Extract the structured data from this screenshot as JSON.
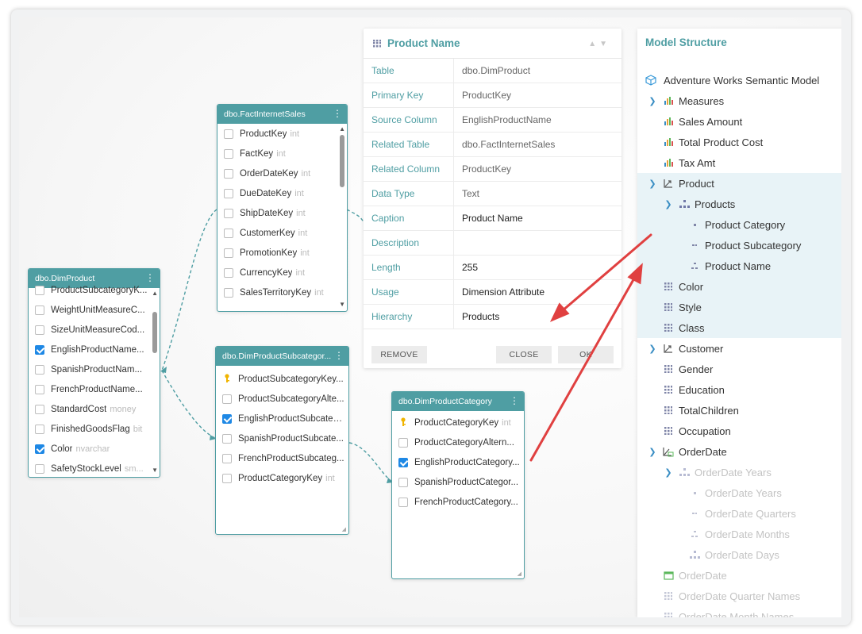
{
  "tables": {
    "fact_internet_sales": {
      "title": "dbo.FactInternetSales",
      "rows": [
        {
          "name": "ProductKey",
          "type": "int"
        },
        {
          "name": "FactKey",
          "type": "int"
        },
        {
          "name": "OrderDateKey",
          "type": "int"
        },
        {
          "name": "DueDateKey",
          "type": "int"
        },
        {
          "name": "ShipDateKey",
          "type": "int"
        },
        {
          "name": "CustomerKey",
          "type": "int"
        },
        {
          "name": "PromotionKey",
          "type": "int"
        },
        {
          "name": "CurrencyKey",
          "type": "int"
        },
        {
          "name": "SalesTerritoryKey",
          "type": "int"
        }
      ]
    },
    "dim_product": {
      "title": "dbo.DimProduct",
      "rows": [
        {
          "name": "ProductSubcategoryK...",
          "type": ""
        },
        {
          "name": "WeightUnitMeasureC...",
          "type": ""
        },
        {
          "name": "SizeUnitMeasureCod...",
          "type": ""
        },
        {
          "name": "EnglishProductName...",
          "type": ""
        },
        {
          "name": "SpanishProductNam...",
          "type": ""
        },
        {
          "name": "FrenchProductName...",
          "type": ""
        },
        {
          "name": "StandardCost",
          "type": "money"
        },
        {
          "name": "FinishedGoodsFlag",
          "type": "bit"
        },
        {
          "name": "Color",
          "type": "nvarchar"
        },
        {
          "name": "SafetyStockLevel",
          "type": "sm..."
        }
      ]
    },
    "dim_product_subcategory": {
      "title": "dbo.DimProductSubcategor...",
      "rows": [
        {
          "name": "ProductSubcategoryKey...",
          "type": ""
        },
        {
          "name": "ProductSubcategoryAlte...",
          "type": ""
        },
        {
          "name": "EnglishProductSubcateg...",
          "type": ""
        },
        {
          "name": "SpanishProductSubcate...",
          "type": ""
        },
        {
          "name": "FrenchProductSubcateg...",
          "type": ""
        },
        {
          "name": "ProductCategoryKey",
          "type": "int"
        }
      ]
    },
    "dim_product_category": {
      "title": "dbo.DimProductCategory",
      "rows": [
        {
          "name": "ProductCategoryKey",
          "type": "int"
        },
        {
          "name": "ProductCategoryAltern...",
          "type": ""
        },
        {
          "name": "EnglishProductCategory...",
          "type": ""
        },
        {
          "name": "SpanishProductCategor...",
          "type": ""
        },
        {
          "name": "FrenchProductCategory...",
          "type": ""
        }
      ]
    }
  },
  "props": {
    "title": "Product Name",
    "rows": [
      {
        "label": "Table",
        "value": "dbo.DimProduct"
      },
      {
        "label": "Primary Key",
        "value": "ProductKey"
      },
      {
        "label": "Source Column",
        "value": "EnglishProductName"
      },
      {
        "label": "Related Table",
        "value": "dbo.FactInternetSales"
      },
      {
        "label": "Related Column",
        "value": "ProductKey"
      },
      {
        "label": "Data Type",
        "value": "Text"
      },
      {
        "label": "Caption",
        "value": "Product Name"
      },
      {
        "label": "Description",
        "value": ""
      },
      {
        "label": "Length",
        "value": "255"
      },
      {
        "label": "Usage",
        "value": "Dimension Attribute"
      },
      {
        "label": "Hierarchy",
        "value": "Products"
      }
    ],
    "remove_label": "REMOVE",
    "close_label": "CLOSE",
    "ok_label": "OK"
  },
  "model": {
    "title": "Model Structure",
    "root": "Adventure Works Semantic Model",
    "items": [
      {
        "label": "Measures"
      },
      {
        "label": "Sales Amount"
      },
      {
        "label": "Total Product Cost"
      },
      {
        "label": "Tax Amt"
      },
      {
        "label": "Product"
      },
      {
        "label": "Products"
      },
      {
        "label": "Product Category"
      },
      {
        "label": "Product Subcategory"
      },
      {
        "label": "Product Name"
      },
      {
        "label": "Color"
      },
      {
        "label": "Style"
      },
      {
        "label": "Class"
      },
      {
        "label": "Customer"
      },
      {
        "label": "Gender"
      },
      {
        "label": "Education"
      },
      {
        "label": "TotalChildren"
      },
      {
        "label": "Occupation"
      },
      {
        "label": "OrderDate"
      },
      {
        "label": "OrderDate Years"
      },
      {
        "label": "OrderDate Years"
      },
      {
        "label": "OrderDate Quarters"
      },
      {
        "label": "OrderDate Months"
      },
      {
        "label": "OrderDate Days"
      },
      {
        "label": "OrderDate"
      },
      {
        "label": "OrderDate Quarter Names"
      },
      {
        "label": "OrderDate Month Names"
      }
    ]
  },
  "colors": {
    "teal": "#4f9ea3",
    "checkbox_blue": "#1e88e5",
    "arrow_red": "#e04040",
    "highlight": "#e8f3f7"
  }
}
